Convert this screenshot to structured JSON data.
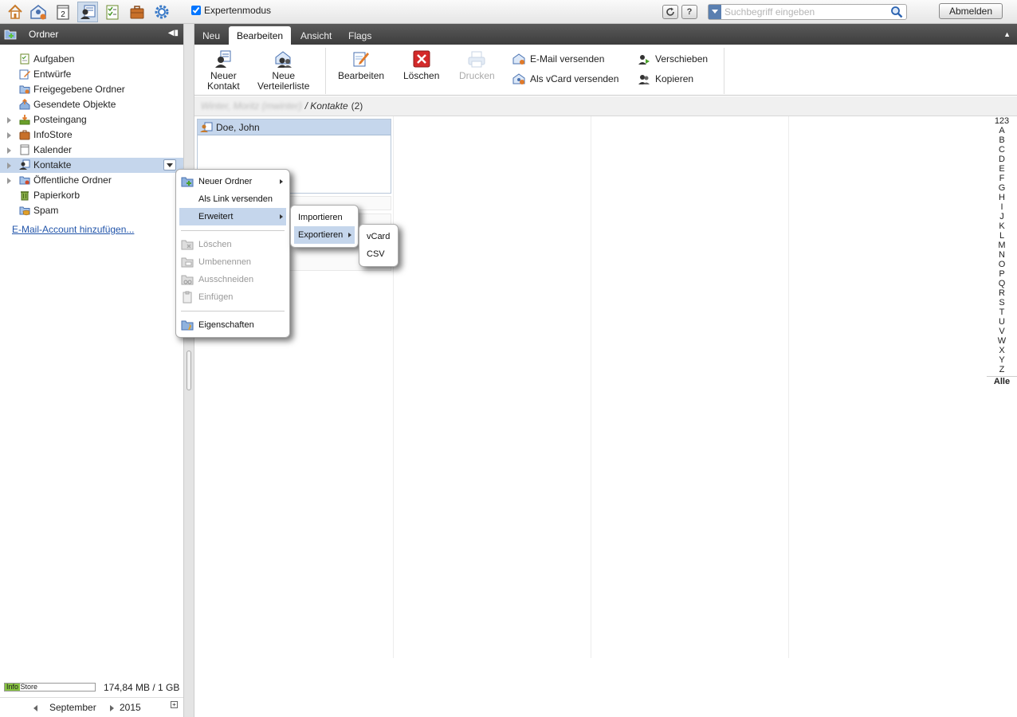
{
  "topbar": {
    "apps": [
      "home-icon",
      "mail-icon",
      "calendar-icon",
      "contacts-icon",
      "tasks-icon",
      "infostore-icon",
      "settings-icon"
    ],
    "calendar_day": "2",
    "expert_mode_label": "Expertenmodus",
    "help_label": "?",
    "search_placeholder": "Suchbegriff eingeben",
    "logout_label": "Abmelden"
  },
  "sidebar": {
    "title": "Ordner",
    "folders": [
      {
        "label": "Aufgaben",
        "icon": "tasks-folder-icon",
        "expandable": false
      },
      {
        "label": "Entwürfe",
        "icon": "drafts-icon",
        "expandable": false
      },
      {
        "label": "Freigegebene Ordner",
        "icon": "shared-folder-icon",
        "expandable": false
      },
      {
        "label": "Gesendete Objekte",
        "icon": "sent-icon",
        "expandable": false
      },
      {
        "label": "Posteingang",
        "icon": "inbox-icon",
        "expandable": true
      },
      {
        "label": "InfoStore",
        "icon": "infostore-icon",
        "expandable": true
      },
      {
        "label": "Kalender",
        "icon": "calendar-folder-icon",
        "expandable": true
      },
      {
        "label": "Kontakte",
        "icon": "contacts-folder-icon",
        "expandable": true,
        "selected": true
      },
      {
        "label": "Öffentliche Ordner",
        "icon": "public-folder-icon",
        "expandable": true
      },
      {
        "label": "Papierkorb",
        "icon": "trash-icon",
        "expandable": false
      },
      {
        "label": "Spam",
        "icon": "spam-icon",
        "expandable": false
      }
    ],
    "add_account": "E-Mail-Account hinzufügen...",
    "quota_label": "Info Store",
    "quota_text": "174,84 MB / 1 GB",
    "mini_calendar": {
      "month": "September",
      "year": "2015"
    }
  },
  "tabs": [
    "Neu",
    "Bearbeiten",
    "Ansicht",
    "Flags"
  ],
  "active_tab": "Bearbeiten",
  "ribbon": {
    "new_contact": [
      "Neuer",
      "Kontakt"
    ],
    "new_list": [
      "Neue",
      "Verteilerliste"
    ],
    "edit": "Bearbeiten",
    "delete": "Löschen",
    "print": "Drucken",
    "send_mail": "E-Mail versenden",
    "send_vcard": "Als vCard versenden",
    "move": "Verschieben",
    "copy": "Kopieren"
  },
  "breadcrumb": {
    "user": "Winter, Moritz (mwinter)",
    "folder": "/ Kontakte",
    "count": "(2)"
  },
  "contact": {
    "name": "Doe, John"
  },
  "alphabet": [
    "123",
    "A",
    "B",
    "C",
    "D",
    "E",
    "F",
    "G",
    "H",
    "I",
    "J",
    "K",
    "L",
    "M",
    "N",
    "O",
    "P",
    "Q",
    "R",
    "S",
    "T",
    "U",
    "V",
    "W",
    "X",
    "Y",
    "Z"
  ],
  "alphabet_all": "Alle",
  "context_menu": {
    "new_folder": "Neuer Ordner",
    "send_link": "Als Link versenden",
    "advanced": "Erweitert",
    "delete": "Löschen",
    "rename": "Umbenennen",
    "cut": "Ausschneiden",
    "paste": "Einfügen",
    "properties": "Eigenschaften"
  },
  "advanced_menu": {
    "import": "Importieren",
    "export": "Exportieren"
  },
  "export_menu": {
    "vcard": "vCard",
    "csv": "CSV"
  },
  "colors": {
    "accent": "#c5d6ec",
    "header": "#4a4a4a",
    "link": "#2255aa"
  }
}
